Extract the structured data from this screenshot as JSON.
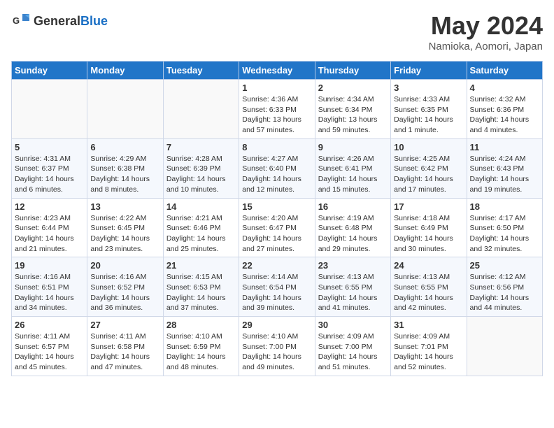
{
  "header": {
    "logo": {
      "general": "General",
      "blue": "Blue"
    },
    "month": "May 2024",
    "location": "Namioka, Aomori, Japan"
  },
  "weekdays": [
    "Sunday",
    "Monday",
    "Tuesday",
    "Wednesday",
    "Thursday",
    "Friday",
    "Saturday"
  ],
  "weeks": [
    [
      {
        "day": "",
        "info": ""
      },
      {
        "day": "",
        "info": ""
      },
      {
        "day": "",
        "info": ""
      },
      {
        "day": "1",
        "info": "Sunrise: 4:36 AM\nSunset: 6:33 PM\nDaylight: 13 hours and 57 minutes."
      },
      {
        "day": "2",
        "info": "Sunrise: 4:34 AM\nSunset: 6:34 PM\nDaylight: 13 hours and 59 minutes."
      },
      {
        "day": "3",
        "info": "Sunrise: 4:33 AM\nSunset: 6:35 PM\nDaylight: 14 hours and 1 minute."
      },
      {
        "day": "4",
        "info": "Sunrise: 4:32 AM\nSunset: 6:36 PM\nDaylight: 14 hours and 4 minutes."
      }
    ],
    [
      {
        "day": "5",
        "info": "Sunrise: 4:31 AM\nSunset: 6:37 PM\nDaylight: 14 hours and 6 minutes."
      },
      {
        "day": "6",
        "info": "Sunrise: 4:29 AM\nSunset: 6:38 PM\nDaylight: 14 hours and 8 minutes."
      },
      {
        "day": "7",
        "info": "Sunrise: 4:28 AM\nSunset: 6:39 PM\nDaylight: 14 hours and 10 minutes."
      },
      {
        "day": "8",
        "info": "Sunrise: 4:27 AM\nSunset: 6:40 PM\nDaylight: 14 hours and 12 minutes."
      },
      {
        "day": "9",
        "info": "Sunrise: 4:26 AM\nSunset: 6:41 PM\nDaylight: 14 hours and 15 minutes."
      },
      {
        "day": "10",
        "info": "Sunrise: 4:25 AM\nSunset: 6:42 PM\nDaylight: 14 hours and 17 minutes."
      },
      {
        "day": "11",
        "info": "Sunrise: 4:24 AM\nSunset: 6:43 PM\nDaylight: 14 hours and 19 minutes."
      }
    ],
    [
      {
        "day": "12",
        "info": "Sunrise: 4:23 AM\nSunset: 6:44 PM\nDaylight: 14 hours and 21 minutes."
      },
      {
        "day": "13",
        "info": "Sunrise: 4:22 AM\nSunset: 6:45 PM\nDaylight: 14 hours and 23 minutes."
      },
      {
        "day": "14",
        "info": "Sunrise: 4:21 AM\nSunset: 6:46 PM\nDaylight: 14 hours and 25 minutes."
      },
      {
        "day": "15",
        "info": "Sunrise: 4:20 AM\nSunset: 6:47 PM\nDaylight: 14 hours and 27 minutes."
      },
      {
        "day": "16",
        "info": "Sunrise: 4:19 AM\nSunset: 6:48 PM\nDaylight: 14 hours and 29 minutes."
      },
      {
        "day": "17",
        "info": "Sunrise: 4:18 AM\nSunset: 6:49 PM\nDaylight: 14 hours and 30 minutes."
      },
      {
        "day": "18",
        "info": "Sunrise: 4:17 AM\nSunset: 6:50 PM\nDaylight: 14 hours and 32 minutes."
      }
    ],
    [
      {
        "day": "19",
        "info": "Sunrise: 4:16 AM\nSunset: 6:51 PM\nDaylight: 14 hours and 34 minutes."
      },
      {
        "day": "20",
        "info": "Sunrise: 4:16 AM\nSunset: 6:52 PM\nDaylight: 14 hours and 36 minutes."
      },
      {
        "day": "21",
        "info": "Sunrise: 4:15 AM\nSunset: 6:53 PM\nDaylight: 14 hours and 37 minutes."
      },
      {
        "day": "22",
        "info": "Sunrise: 4:14 AM\nSunset: 6:54 PM\nDaylight: 14 hours and 39 minutes."
      },
      {
        "day": "23",
        "info": "Sunrise: 4:13 AM\nSunset: 6:55 PM\nDaylight: 14 hours and 41 minutes."
      },
      {
        "day": "24",
        "info": "Sunrise: 4:13 AM\nSunset: 6:55 PM\nDaylight: 14 hours and 42 minutes."
      },
      {
        "day": "25",
        "info": "Sunrise: 4:12 AM\nSunset: 6:56 PM\nDaylight: 14 hours and 44 minutes."
      }
    ],
    [
      {
        "day": "26",
        "info": "Sunrise: 4:11 AM\nSunset: 6:57 PM\nDaylight: 14 hours and 45 minutes."
      },
      {
        "day": "27",
        "info": "Sunrise: 4:11 AM\nSunset: 6:58 PM\nDaylight: 14 hours and 47 minutes."
      },
      {
        "day": "28",
        "info": "Sunrise: 4:10 AM\nSunset: 6:59 PM\nDaylight: 14 hours and 48 minutes."
      },
      {
        "day": "29",
        "info": "Sunrise: 4:10 AM\nSunset: 7:00 PM\nDaylight: 14 hours and 49 minutes."
      },
      {
        "day": "30",
        "info": "Sunrise: 4:09 AM\nSunset: 7:00 PM\nDaylight: 14 hours and 51 minutes."
      },
      {
        "day": "31",
        "info": "Sunrise: 4:09 AM\nSunset: 7:01 PM\nDaylight: 14 hours and 52 minutes."
      },
      {
        "day": "",
        "info": ""
      }
    ]
  ]
}
